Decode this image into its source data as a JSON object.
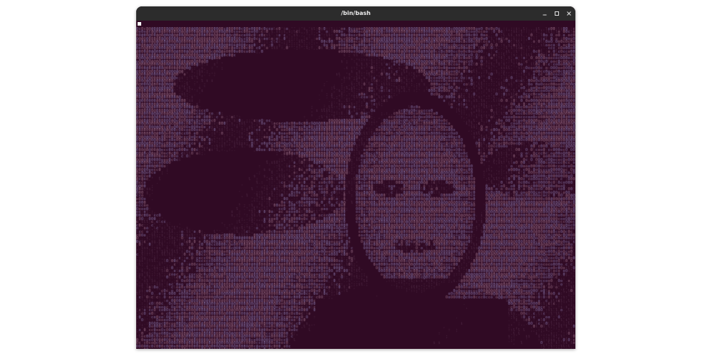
{
  "window": {
    "title": "/bin/bash"
  },
  "controls": {
    "minimize_icon": "minimize-icon",
    "maximize_icon": "maximize-icon",
    "close_icon": "close-icon"
  },
  "terminal": {
    "background": "#300a24",
    "cursor_color": "#ffffff",
    "prompt_text": "",
    "art_palette": {
      "lavender": "#8f7fb3",
      "mauve": "#a3778f",
      "dim": "#5a3551"
    }
  }
}
